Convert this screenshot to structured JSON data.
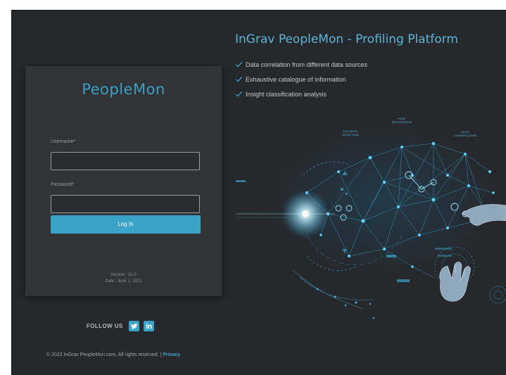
{
  "login": {
    "logo_text": "PeopleMon",
    "username_label": "Username*",
    "username_value": "",
    "password_label": "Password*",
    "password_value": "",
    "login_button": "Log In",
    "version": "Version : 32.0",
    "date": "Date : June 1, 2021"
  },
  "follow": {
    "label": "FOLLOW US",
    "icons": [
      "twitter-icon",
      "linkedin-icon"
    ]
  },
  "footer": {
    "copyright": "© 2022 InGrav PeopleMon.com, All rights reserved. | ",
    "privacy": "Privacy"
  },
  "hero": {
    "title": "InGrav PeopleMon - Profiling Platform",
    "features": [
      "Data correlation from different data sources",
      "Exhaustive catalogue of information",
      "Insight classification analysis"
    ],
    "art_labels": {
      "face": "FACE\nRECOGNITION",
      "location": "LOCATION\nDETECTION",
      "auto": "AUTO\nCLASSIFICATION"
    }
  },
  "colors": {
    "background": "#26282c",
    "card": "#313337",
    "accent": "#3aa3c8"
  }
}
